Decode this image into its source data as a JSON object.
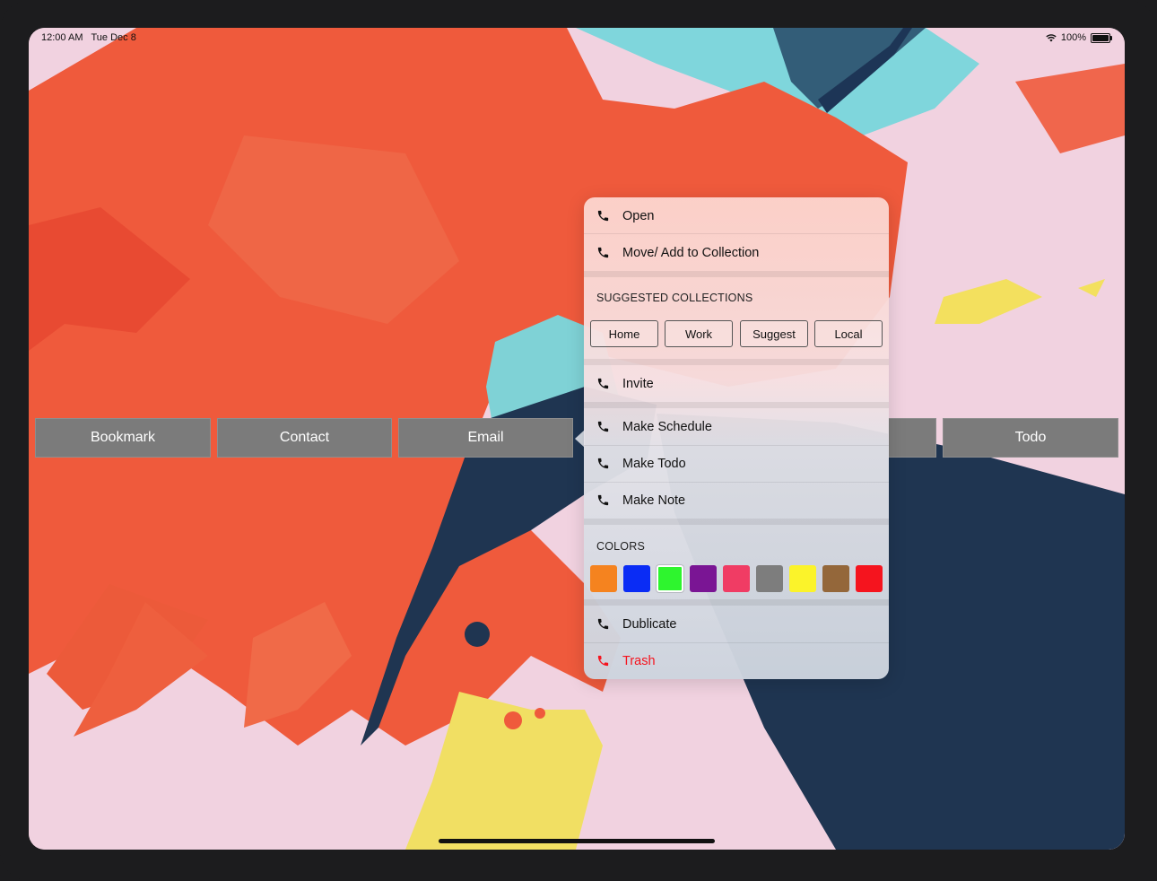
{
  "status_bar": {
    "time": "12:00 AM",
    "date": "Tue Dec 8",
    "battery": "100%"
  },
  "buttons": [
    "Bookmark",
    "Contact",
    "Email",
    "Todo"
  ],
  "menu": {
    "items_top": [
      {
        "label": "Open",
        "icon": "phone-icon"
      },
      {
        "label": "Move/ Add to Collection",
        "icon": "phone-icon"
      }
    ],
    "suggested_header": "SUGGESTED COLLECTIONS",
    "collections": [
      "Home",
      "Work",
      "Suggest",
      "Local"
    ],
    "invite": {
      "label": "Invite",
      "icon": "phone-icon"
    },
    "items_middle": [
      {
        "label": "Make Schedule",
        "icon": "phone-icon"
      },
      {
        "label": "Make Todo",
        "icon": "phone-icon"
      },
      {
        "label": "Make Note",
        "icon": "phone-icon"
      }
    ],
    "colors_header": "COLORS",
    "colors": [
      "#f5831f",
      "#0a2cf5",
      "#2ef52e",
      "#7a1594",
      "#f03c64",
      "#7d7d7d",
      "#fbf32a",
      "#94673a",
      "#f5141e"
    ],
    "selected_color": "#2ef52e",
    "items_bottom": [
      {
        "label": "Dublicate",
        "icon": "phone-icon"
      },
      {
        "label": "Trash",
        "icon": "phone-icon",
        "destructive": true
      }
    ],
    "destructive_color": "#f5141e"
  }
}
